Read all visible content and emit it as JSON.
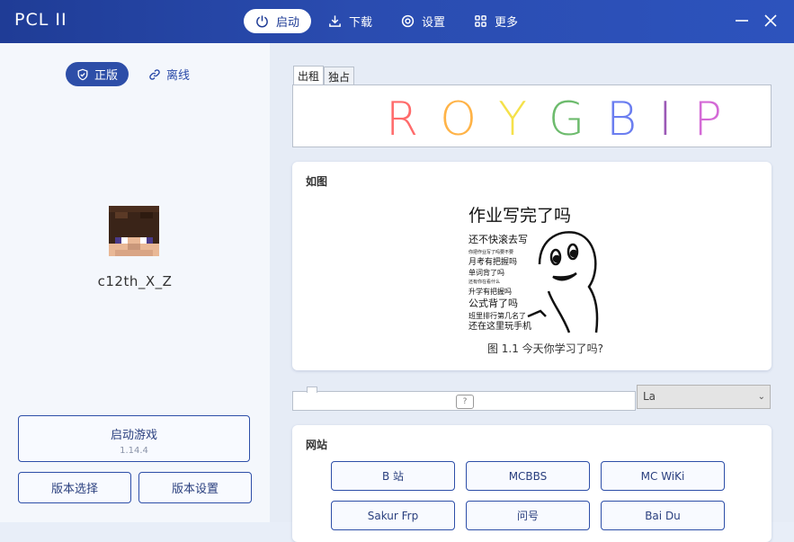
{
  "app": {
    "title": "PCL II"
  },
  "nav": [
    {
      "label": "启动",
      "icon": "power-icon",
      "active": true
    },
    {
      "label": "下载",
      "icon": "download-icon",
      "active": false
    },
    {
      "label": "设置",
      "icon": "settings-icon",
      "active": false
    },
    {
      "label": "更多",
      "icon": "grid-icon",
      "active": false
    }
  ],
  "window": {
    "minimize_icon": "minimize-icon",
    "close_icon": "close-icon"
  },
  "login": {
    "modes": [
      {
        "label": "正版",
        "icon": "shield-check-icon",
        "active": true
      },
      {
        "label": "离线",
        "icon": "link-icon",
        "active": false
      }
    ],
    "username": "c12th_X_Z"
  },
  "launch": {
    "label": "启动游戏",
    "version": "1.14.4"
  },
  "buttons": {
    "version_select": "版本选择",
    "version_settings": "版本设置"
  },
  "tabs": [
    {
      "label": "出租",
      "active": true
    },
    {
      "label": "独占",
      "active": false
    }
  ],
  "rainbow": {
    "letters": [
      "R",
      "O",
      "Y",
      "G",
      "B",
      "I",
      "P"
    ],
    "colors": [
      "#ff6b6b",
      "#ffb347",
      "#f5e14a",
      "#6dbb6d",
      "#6b7ef0",
      "#9b59b6",
      "#d46ad6"
    ]
  },
  "image_card": {
    "title": "如图",
    "meme": {
      "headline": "作业写完了吗",
      "lines": [
        "还不快滚去写",
        "你把作业写了吗要不要",
        "月考有把握吗",
        "单词背了吗",
        "还有你在看什么",
        "升学有把握吗",
        "公式背了吗",
        "班里排行第几名了",
        "还在这里玩手机"
      ]
    },
    "caption": "图 1.1 今天你学习了吗?"
  },
  "input": {
    "help": "?"
  },
  "language_select": {
    "value": "La"
  },
  "sites": {
    "title": "网站",
    "links": [
      "B 站",
      "MCBBS",
      "MC WiKi",
      "Sakur Frp",
      "问号",
      "Bai Du"
    ]
  }
}
